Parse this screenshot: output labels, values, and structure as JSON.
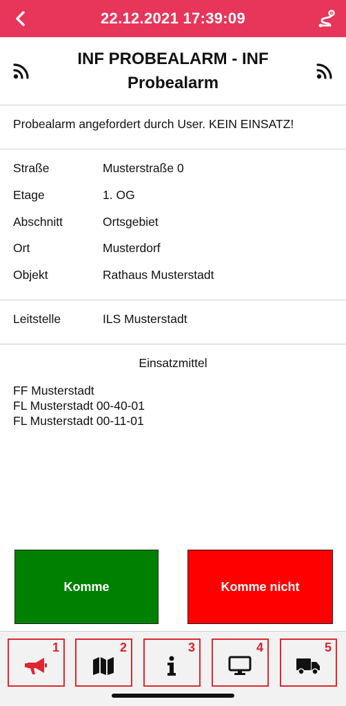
{
  "topbar": {
    "datetime": "22.12.2021 17:39:09",
    "back_icon": "chevron-left-icon",
    "route_icon": "route-icon",
    "bg_color": "#e8365a"
  },
  "header": {
    "title": "INF PROBEALARM - INF Probealarm",
    "feed_icon": "rss-icon"
  },
  "message": "Probealarm angefordert durch User. KEIN EINSATZ!",
  "details": [
    {
      "key": "Straße",
      "value": "Musterstraße 0"
    },
    {
      "key": "Etage",
      "value": "1. OG"
    },
    {
      "key": "Abschnitt",
      "value": "Ortsgebiet"
    },
    {
      "key": "Ort",
      "value": "Musterdorf"
    },
    {
      "key": "Objekt",
      "value": "Rathaus Musterstadt"
    }
  ],
  "leitstelle": {
    "key": "Leitstelle",
    "value": "ILS Musterstadt"
  },
  "einsatzmittel": {
    "heading": "Einsatzmittel",
    "units": [
      "FF Musterstadt",
      "FL Musterstadt 00-40-01",
      "FL Musterstadt 00-11-01"
    ]
  },
  "actions": {
    "accept_label": "Komme",
    "accept_color": "#008000",
    "decline_label": "Komme nicht",
    "decline_color": "#ff0000"
  },
  "tabs": [
    {
      "num": "1",
      "icon": "megaphone-icon"
    },
    {
      "num": "2",
      "icon": "map-icon"
    },
    {
      "num": "3",
      "icon": "info-icon"
    },
    {
      "num": "4",
      "icon": "monitor-icon"
    },
    {
      "num": "5",
      "icon": "truck-icon"
    }
  ]
}
